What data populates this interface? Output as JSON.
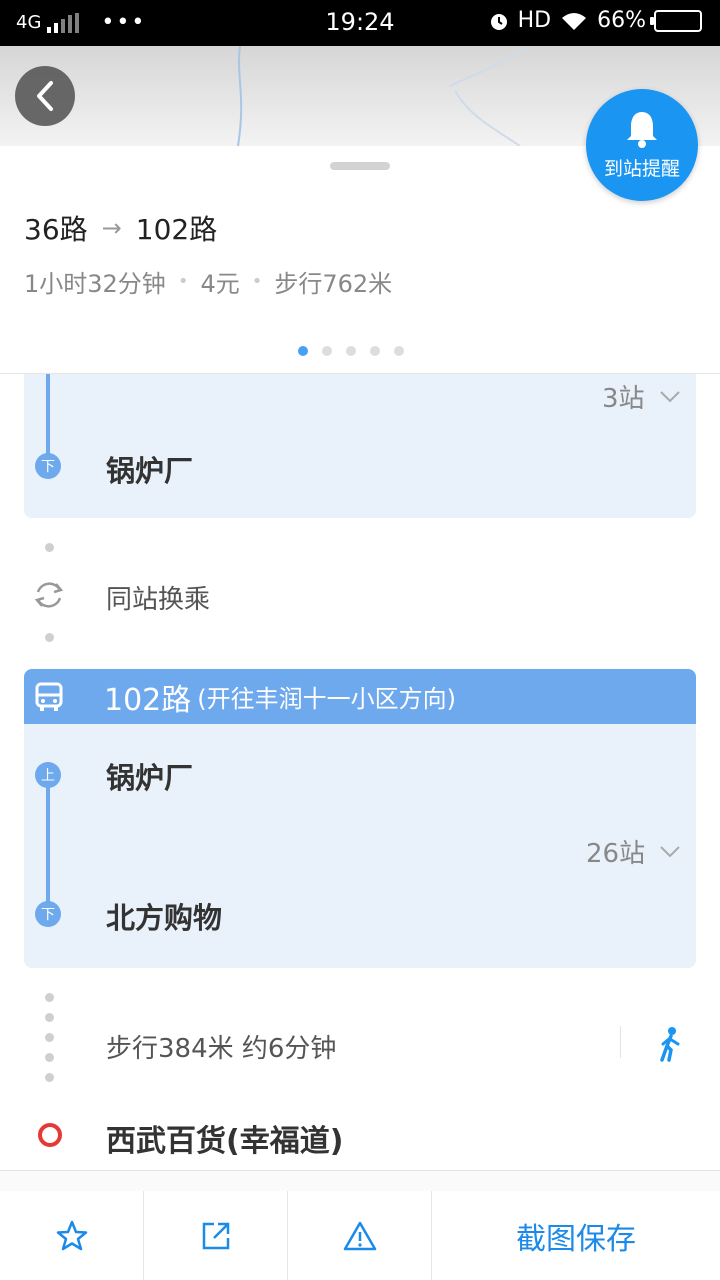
{
  "status_bar": {
    "network": "4G",
    "more": "•••",
    "time": "19:24",
    "hd": "HD",
    "battery": "66%",
    "battery_level": 0.66
  },
  "header": {
    "alert_label": "到站提醒"
  },
  "summary": {
    "from_line": "36路",
    "to_line": "102路",
    "duration": "1小时32分钟",
    "fare": "4元",
    "walk": "步行762米",
    "page_count": 5,
    "active_page": 1
  },
  "segments": {
    "first": {
      "stops": "3站",
      "alight_badge": "下",
      "alight_station": "锅炉厂"
    },
    "transfer": {
      "text": "同站换乘"
    },
    "bus": {
      "line": "102路",
      "direction": "(开往丰润十一小区方向)",
      "board_badge": "上",
      "board_station": "锅炉厂",
      "stops": "26站",
      "alight_badge": "下",
      "alight_station": "北方购物"
    },
    "walk": {
      "text": "步行384米 约6分钟"
    },
    "destination": {
      "name": "西武百货(幸福道)"
    }
  },
  "bottom_bar": {
    "save_label": "截图保存"
  },
  "colors": {
    "accent": "#1b95f2",
    "line_blue": "#6ea9ee",
    "card_bg": "#e9f1fb",
    "dest_red": "#e53935"
  }
}
